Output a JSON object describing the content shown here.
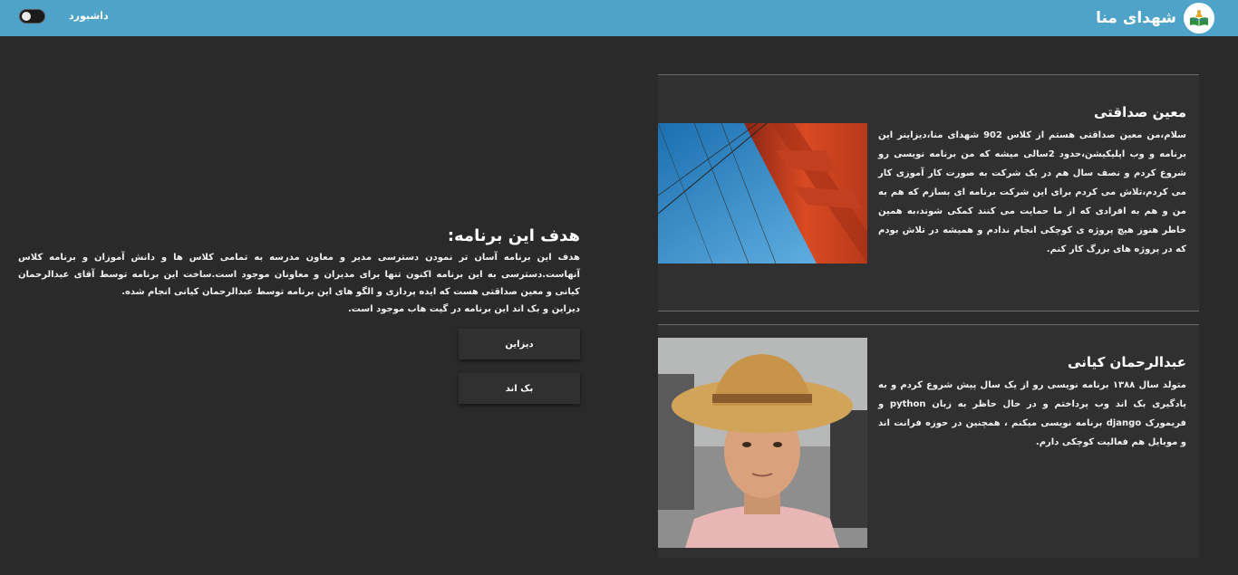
{
  "header": {
    "brand_title": "شهدای منا",
    "nav_dashboard": "داشبورد"
  },
  "cards": [
    {
      "name": "معین صداقتی",
      "bio": "سلام،من معین صداقتی هستم از کلاس 902 شهدای منا،دیزاینر این برنامه و وب اپلیکیشن،حدود 2سالی میشه که من برنامه نویسی رو شروع کردم و نصف سال هم در یک شرکت به صورت کار آموزی کار می کردم،تلاش می کردم برای این شرکت برنامه ای بسازم که هم به من و هم به افرادی که از ما حمایت می کنند کمکی شوند،به همین خاطر هنوز هیچ پروژه ی کوچکی انجام ندادم و همیشه در تلاش بودم که در پروژه های بزرگ کار کنم."
    },
    {
      "name": "عبدالرحمان کیانی",
      "bio": "متولد سال ۱۳۸۸ برنامه نویسی رو از یک سال پیش شروع کردم و به یادگیری بک اند وب پرداختم و در حال حاظر به زبان python و فریمورک django برنامه نویسی میکنم ، همچنین در حوزه فرانت اند و موبایل هم فعالیت کوچکی دارم."
    }
  ],
  "goal": {
    "title": "هدف این برنامه:",
    "text": "هدف این برنامه آسان تر نمودن دسترسی مدیر و معاون مدرسه به تمامی کلاس ها و دانش آموزان و برنامه کلاس آنهاست.دسترسی به این برنامه اکنون تنها برای مدیران و معاونان موجود است.ساخت این برنامه توسط آقای عبدالرحمان کیانی و معین صداقتی هست که ایده پردازی و الگو های این برنامه توسط عبدالرحمان کیانی انجام شده.",
    "note": "دیزاین و بک اند این برنامه در گیت هاب موجود است."
  },
  "buttons": {
    "design": "دیزاین",
    "backend": "بک اند"
  },
  "colors": {
    "header": "#4fa3c9",
    "background": "#2a2a2a",
    "card": "#303030"
  }
}
